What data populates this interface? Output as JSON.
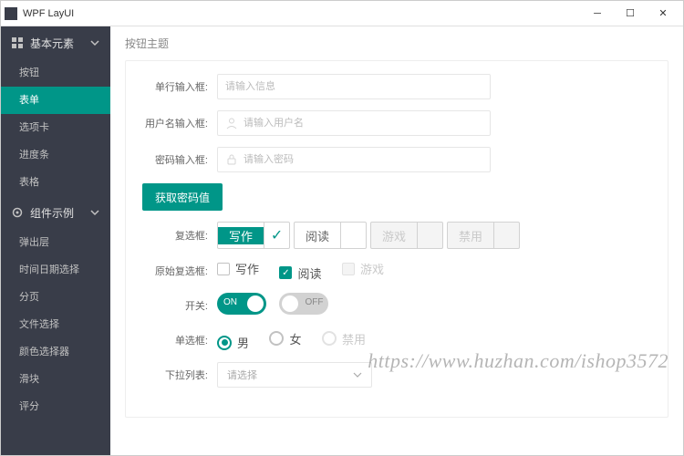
{
  "window": {
    "title": "WPF LayUI"
  },
  "sidebar": {
    "groups": [
      {
        "label": "基本元素",
        "items": [
          "按钮",
          "表单",
          "选项卡",
          "进度条",
          "表格"
        ],
        "active_index": 1
      },
      {
        "label": "组件示例",
        "items": [
          "弹出层",
          "时间日期选择",
          "分页",
          "文件选择",
          "颜色选择器",
          "滑块",
          "评分"
        ]
      }
    ]
  },
  "page": {
    "heading": "按钮主题"
  },
  "form": {
    "single_input": {
      "label": "单行输入框:",
      "placeholder": "请输入信息"
    },
    "user_input": {
      "label": "用户名输入框:",
      "placeholder": "请输入用户名"
    },
    "password_input": {
      "label": "密码输入框:",
      "placeholder": "请输入密码"
    },
    "get_pwd_btn": "获取密码值",
    "checkbox": {
      "label": "复选框:",
      "items": [
        {
          "text": "写作",
          "checked": true,
          "disabled": false
        },
        {
          "text": "阅读",
          "checked": false,
          "disabled": false
        },
        {
          "text": "游戏",
          "checked": false,
          "disabled": true
        },
        {
          "text": "禁用",
          "checked": false,
          "disabled": true
        }
      ]
    },
    "native_checkbox": {
      "label": "原始复选框:",
      "items": [
        {
          "text": "写作",
          "checked": false,
          "disabled": false
        },
        {
          "text": "阅读",
          "checked": true,
          "disabled": false
        },
        {
          "text": "游戏",
          "checked": false,
          "disabled": true
        }
      ]
    },
    "switch": {
      "label": "开关:",
      "on_text": "ON",
      "off_text": "OFF"
    },
    "radio": {
      "label": "单选框:",
      "items": [
        {
          "text": "男",
          "checked": true,
          "disabled": false
        },
        {
          "text": "女",
          "checked": false,
          "disabled": false
        },
        {
          "text": "禁用",
          "checked": false,
          "disabled": true
        }
      ]
    },
    "select": {
      "label": "下拉列表:",
      "placeholder": "请选择"
    }
  },
  "watermark": "https://www.huzhan.com/ishop3572"
}
